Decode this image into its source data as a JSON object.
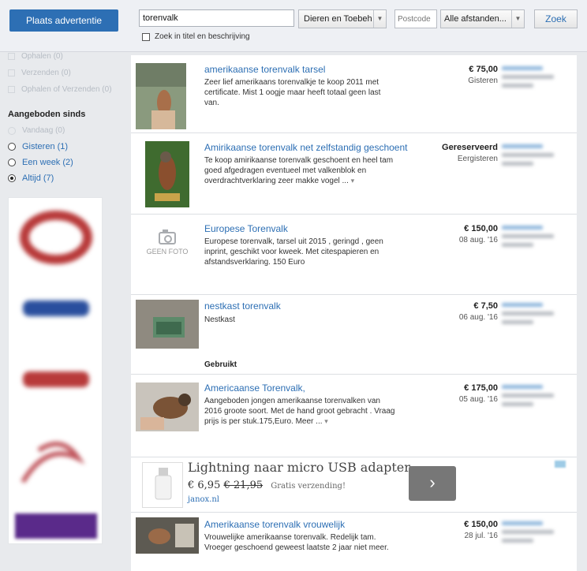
{
  "header": {
    "place_button": "Plaats advertentie",
    "search_value": "torenvalk",
    "category": "Dieren en Toebeh",
    "postcode_placeholder": "Postcode",
    "distance": "Alle afstanden...",
    "search_button": "Zoek",
    "title_check_label": "Zoek in titel en beschrijving"
  },
  "sidebar": {
    "delivery_options": [
      "Ophalen (0)",
      "Verzenden (0)",
      "Ophalen of Verzenden (0)"
    ],
    "since_heading": "Aangeboden sinds",
    "since_options": [
      {
        "label": "Vandaag (0)",
        "state": "disabled"
      },
      {
        "label": "Gisteren (1)",
        "state": "unchecked"
      },
      {
        "label": "Een week (2)",
        "state": "unchecked"
      },
      {
        "label": "Altijd (7)",
        "state": "checked"
      }
    ]
  },
  "listings": [
    {
      "title": "amerikaanse torenvalk tarsel",
      "description": "Zeer lief amerikaans torenvalkje te koop 2011 met certificate. Mist 1 oogje maar heeft totaal geen last van.",
      "price": "€ 75,00",
      "date": "Gisteren"
    },
    {
      "title": "Amirikaanse torenvalk net zelfstandig geschoent",
      "description": "Te koop amirikaanse torenvalk geschoent en heel tam goed afgedragen eventueel met valkenblok en overdrachtverklaring zeer makke vogel ...",
      "price": "Gereserveerd",
      "date": "Eergisteren"
    },
    {
      "title": "Europese Torenvalk",
      "description": "Europese torenvalk, tarsel uit 2015 , geringd , geen inprint, geschikt voor kweek. Met citespapieren en afstandsverklaring. 150 Euro",
      "price": "€ 150,00",
      "date": "08 aug. '16",
      "no_photo_label": "GEEN FOTO"
    },
    {
      "title": "nestkast torenvalk",
      "description": "Nestkast",
      "price": "€ 7,50",
      "date": "06 aug. '16",
      "condition": "Gebruikt"
    },
    {
      "title": "Americaanse Torenvalk,",
      "description": "Aangeboden jongen amerikaanse torenvalken van 2016 groote soort. Met de hand groot gebracht . Vraag prijs is per stuk.175,Euro. Meer ...",
      "price": "€ 175,00",
      "date": "05 aug. '16"
    },
    {
      "title": "Amerikaanse torenvalk vrouwelijk",
      "description": "Vrouwelijke amerikaanse torenvalk. Redelijk tam. Vroeger geschoend geweest laatste 2 jaar niet meer.",
      "price": "€ 150,00",
      "date": "28 jul. '16"
    }
  ],
  "ad": {
    "title": "Lightning naar micro USB adapter",
    "price_new": "€ 6,95",
    "price_old": "€ 21,95",
    "shipping": "Gratis verzending!",
    "link": "janox.nl",
    "arrow": "›"
  },
  "colors": {
    "accent": "#2d6fb4",
    "page_background": "#e8eaed"
  }
}
